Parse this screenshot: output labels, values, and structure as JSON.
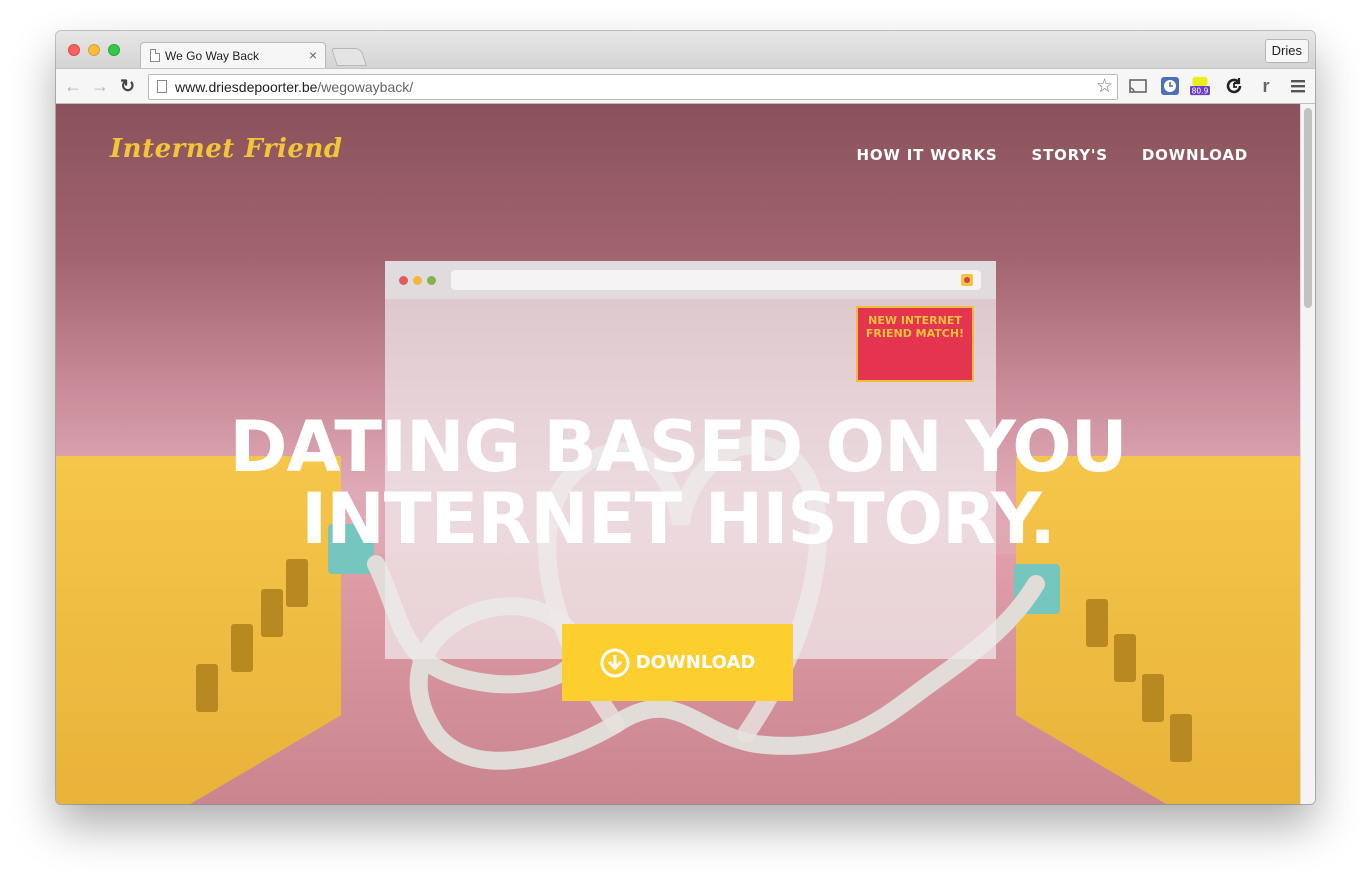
{
  "browser": {
    "tab_title": "We Go Way Back",
    "tab_close": "×",
    "profile_name": "Dries",
    "url_domain": "www.driesdepoorter.be",
    "url_path": "/wegowayback/",
    "extension_badge": "80.9",
    "extension_r": "r"
  },
  "site": {
    "logo": "Internet Friend",
    "nav": [
      "HOW IT WORKS",
      "STORY'S",
      "DOWNLOAD"
    ],
    "match_card": "NEW INTERNET FRIEND MATCH!",
    "headline_line1": "DATING BASED ON YOU",
    "headline_line2": "INTERNET HISTORY.",
    "download_label": "DOWNLOAD"
  },
  "colors": {
    "accent_yellow": "#fcce2e",
    "logo_yellow": "#f3c63a",
    "match_red": "#e4344f"
  }
}
